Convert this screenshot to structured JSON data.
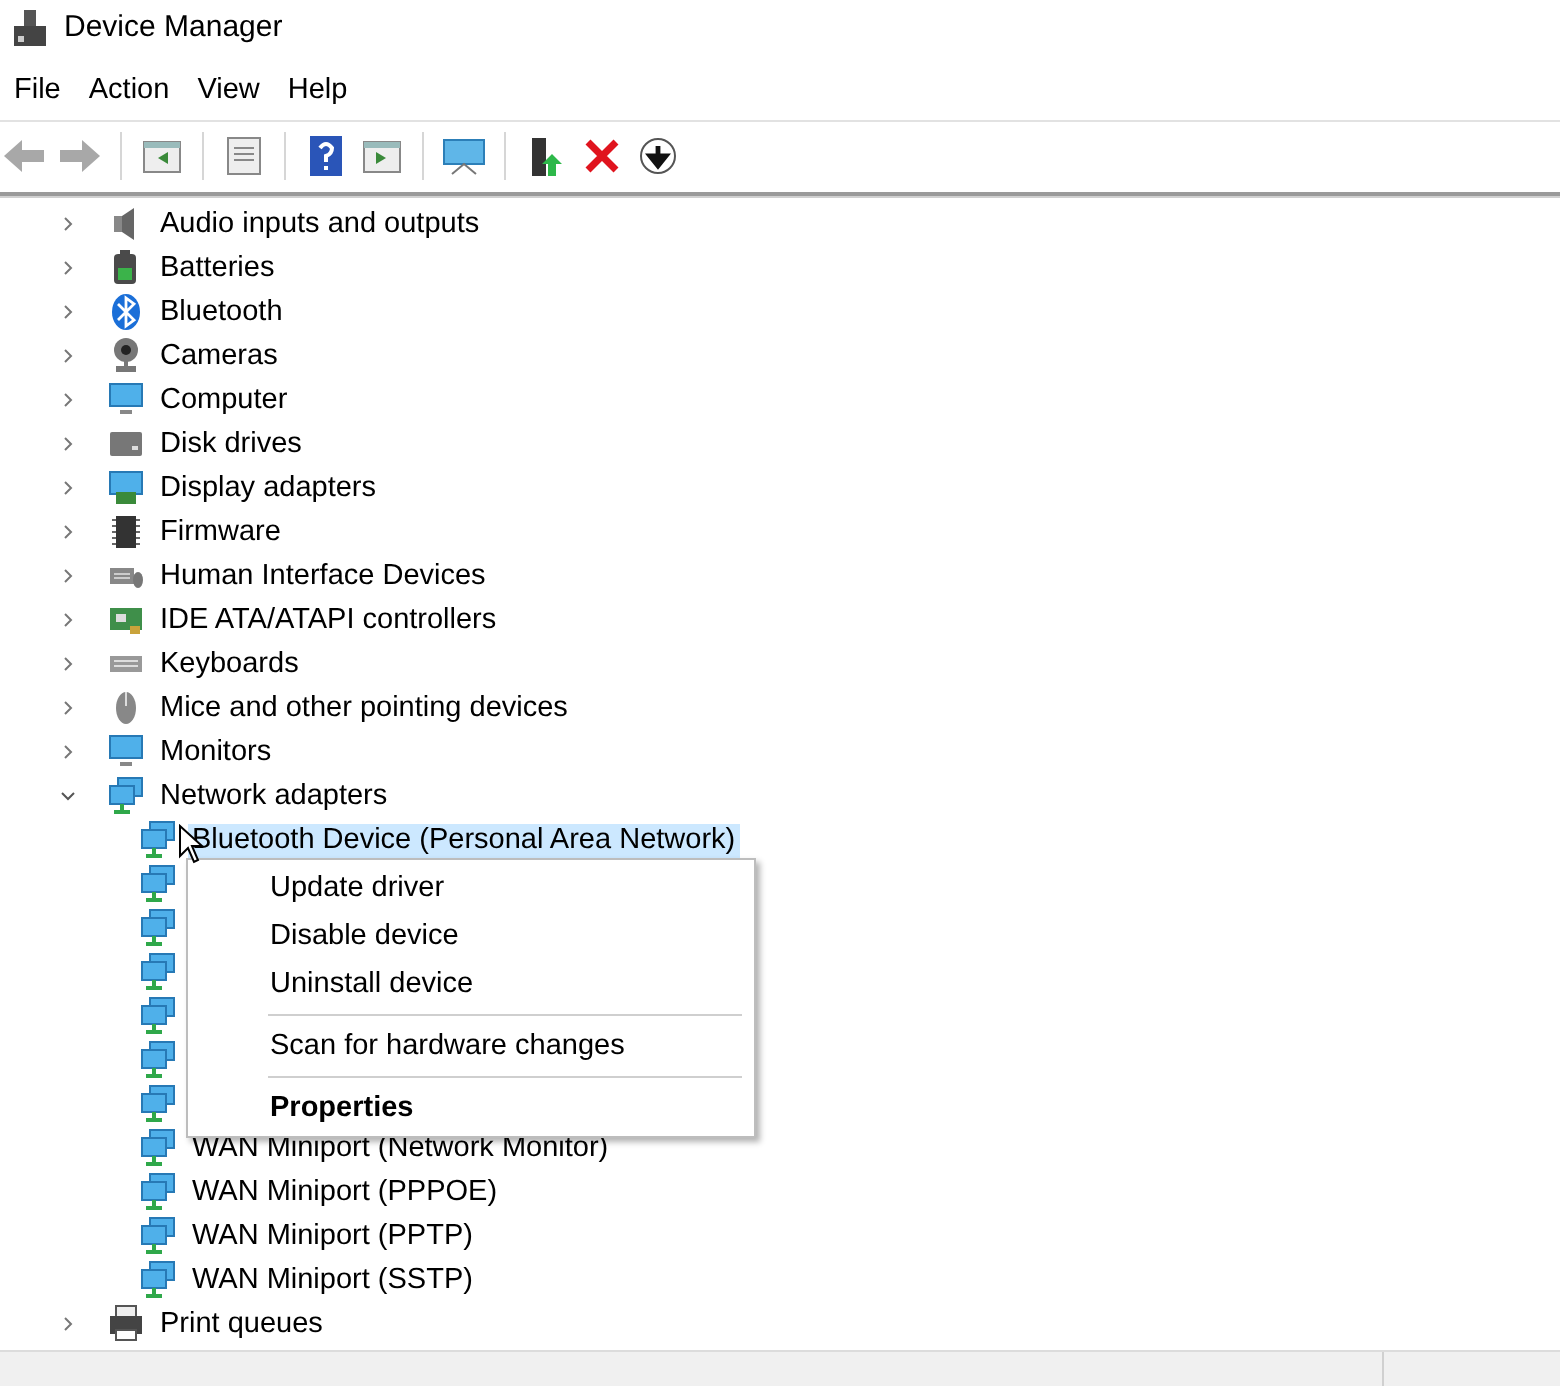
{
  "window": {
    "title": "Device Manager"
  },
  "menu": [
    "File",
    "Action",
    "View",
    "Help"
  ],
  "tree": [
    {
      "label": "Audio inputs and outputs",
      "kind": "speaker",
      "expanded": false
    },
    {
      "label": "Batteries",
      "kind": "battery",
      "expanded": false
    },
    {
      "label": "Bluetooth",
      "kind": "bluetooth",
      "expanded": false
    },
    {
      "label": "Cameras",
      "kind": "camera",
      "expanded": false
    },
    {
      "label": "Computer",
      "kind": "monitor",
      "expanded": false
    },
    {
      "label": "Disk drives",
      "kind": "drive",
      "expanded": false
    },
    {
      "label": "Display adapters",
      "kind": "display",
      "expanded": false
    },
    {
      "label": "Firmware",
      "kind": "chip",
      "expanded": false
    },
    {
      "label": "Human Interface Devices",
      "kind": "hid",
      "expanded": false
    },
    {
      "label": "IDE ATA/ATAPI controllers",
      "kind": "ide",
      "expanded": false
    },
    {
      "label": "Keyboards",
      "kind": "keyboard",
      "expanded": false
    },
    {
      "label": "Mice and other pointing devices",
      "kind": "mouse",
      "expanded": false
    },
    {
      "label": "Monitors",
      "kind": "monitor",
      "expanded": false
    },
    {
      "label": "Network adapters",
      "kind": "network",
      "expanded": true,
      "children": [
        {
          "label": "Bluetooth Device (Personal Area Network)",
          "kind": "network",
          "selected": true
        },
        {
          "kind": "network"
        },
        {
          "kind": "network"
        },
        {
          "kind": "network"
        },
        {
          "kind": "network"
        },
        {
          "kind": "network"
        },
        {
          "kind": "network"
        },
        {
          "label": "WAN Miniport (Network Monitor)",
          "kind": "network",
          "selected": false
        },
        {
          "label": "WAN Miniport (PPPOE)",
          "kind": "network",
          "selected": false
        },
        {
          "label": "WAN Miniport (PPTP)",
          "kind": "network",
          "selected": false
        },
        {
          "label": "WAN Miniport (SSTP)",
          "kind": "network",
          "selected": false
        }
      ]
    },
    {
      "label": "Print queues",
      "kind": "printer",
      "expanded": false
    }
  ],
  "context_menu": [
    {
      "label": "Update driver",
      "kind": "item"
    },
    {
      "label": "Disable device",
      "kind": "item"
    },
    {
      "label": "Uninstall device",
      "kind": "item"
    },
    {
      "kind": "separator"
    },
    {
      "label": "Scan for hardware changes",
      "kind": "item"
    },
    {
      "kind": "separator"
    },
    {
      "label": "Properties",
      "kind": "default"
    }
  ]
}
